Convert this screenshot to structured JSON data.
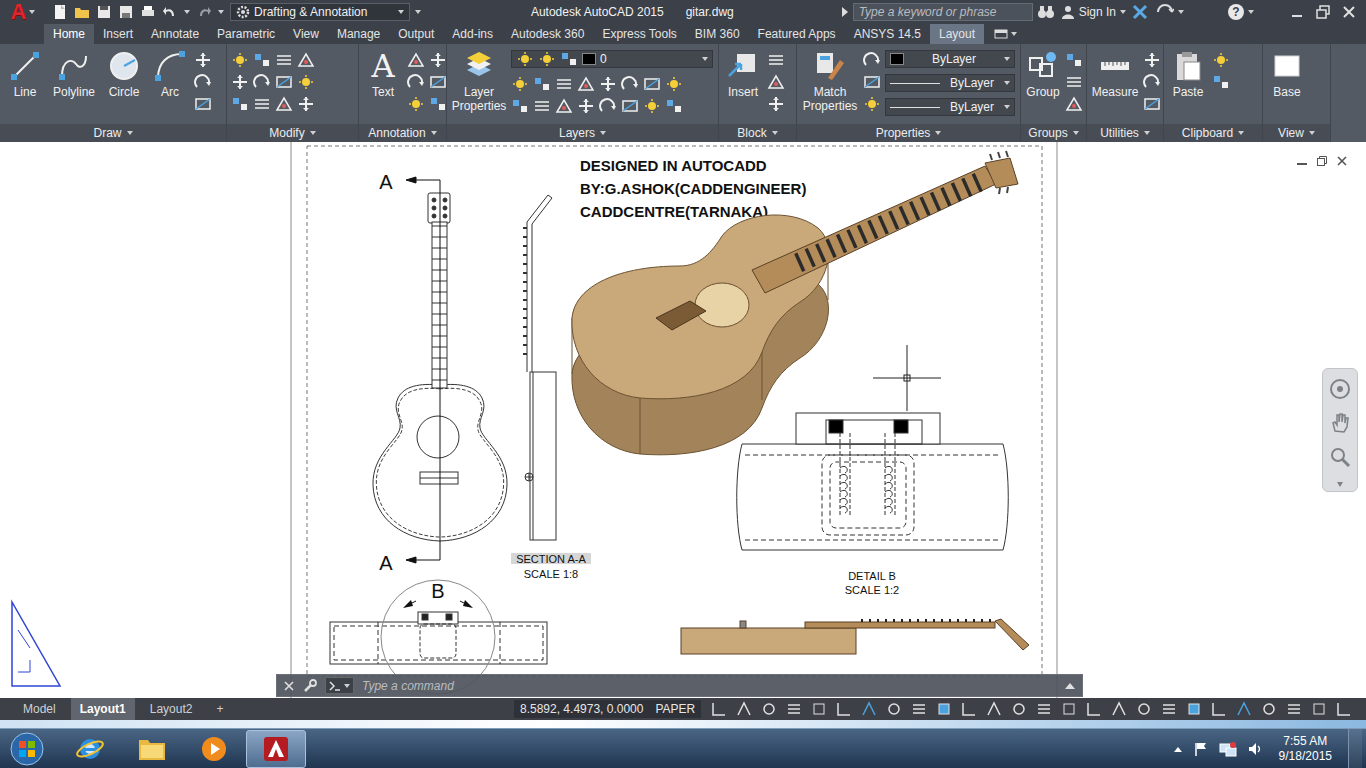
{
  "app_button": {
    "label": "A"
  },
  "window": {
    "title": "Autodesk AutoCAD 2015",
    "file": "gitar.dwg"
  },
  "workspace": {
    "label": "Drafting & Annotation"
  },
  "search": {
    "placeholder": "Type a keyword or phrase"
  },
  "account": {
    "label": "Sign In"
  },
  "help": {
    "label": "?"
  },
  "ribbon_tabs": [
    {
      "label": "Home",
      "selected": true,
      "contextual": false
    },
    {
      "label": "Insert",
      "selected": false,
      "contextual": false
    },
    {
      "label": "Annotate",
      "selected": false,
      "contextual": false
    },
    {
      "label": "Parametric",
      "selected": false,
      "contextual": false
    },
    {
      "label": "View",
      "selected": false,
      "contextual": false
    },
    {
      "label": "Manage",
      "selected": false,
      "contextual": false
    },
    {
      "label": "Output",
      "selected": false,
      "contextual": false
    },
    {
      "label": "Add-ins",
      "selected": false,
      "contextual": false
    },
    {
      "label": "Autodesk 360",
      "selected": false,
      "contextual": false
    },
    {
      "label": "Express Tools",
      "selected": false,
      "contextual": false
    },
    {
      "label": "BIM 360",
      "selected": false,
      "contextual": false
    },
    {
      "label": "Featured Apps",
      "selected": false,
      "contextual": false
    },
    {
      "label": "ANSYS 14.5",
      "selected": false,
      "contextual": false
    },
    {
      "label": "Layout",
      "selected": false,
      "contextual": true
    }
  ],
  "ribbon_panels": [
    {
      "title": "Draw",
      "tools": [
        "Line",
        "Polyline",
        "Circle",
        "Arc"
      ]
    },
    {
      "title": "Modify",
      "tools": []
    },
    {
      "title": "Annotation",
      "tools": [
        "Text"
      ],
      "glyph": "A"
    },
    {
      "title": "Layers",
      "tools": [
        "Layer Properties"
      ],
      "layer": "0"
    },
    {
      "title": "Block",
      "tools": [
        "Insert"
      ]
    },
    {
      "title": "Properties",
      "tools": [
        "Match Properties"
      ],
      "fields": [
        "ByLayer",
        "ByLayer",
        "ByLayer"
      ]
    },
    {
      "title": "Groups",
      "tools": [
        "Group"
      ]
    },
    {
      "title": "Utilities",
      "tools": [
        "Measure"
      ]
    },
    {
      "title": "Clipboard",
      "tools": [
        "Paste"
      ]
    },
    {
      "title": "View",
      "tools": [
        "Base"
      ]
    }
  ],
  "drawing": {
    "title_lines": [
      "DESIGNED IN AUTOCADD",
      "BY:G.ASHOK(CADDENGINEER)",
      "CADDCENTRE(TARNAKA)"
    ],
    "section_marks": [
      "A",
      "A"
    ],
    "detail_mark": "B",
    "labels": [
      {
        "title": "SECTION A-A",
        "scale": "SCALE 1:8"
      },
      {
        "title": "DETAIL B",
        "scale": "SCALE 1:2"
      }
    ]
  },
  "command_line": {
    "placeholder": "Type a command"
  },
  "layout_tabs": [
    {
      "label": "Model",
      "selected": false
    },
    {
      "label": "Layout1",
      "selected": true
    },
    {
      "label": "Layout2",
      "selected": false
    }
  ],
  "new_layout": "+",
  "status_bar": {
    "coordinates": "8.5892, 4.4973, 0.0000",
    "space": "PAPER"
  },
  "taskbar": {
    "time": "7:55 AM",
    "date": "9/18/2015"
  }
}
